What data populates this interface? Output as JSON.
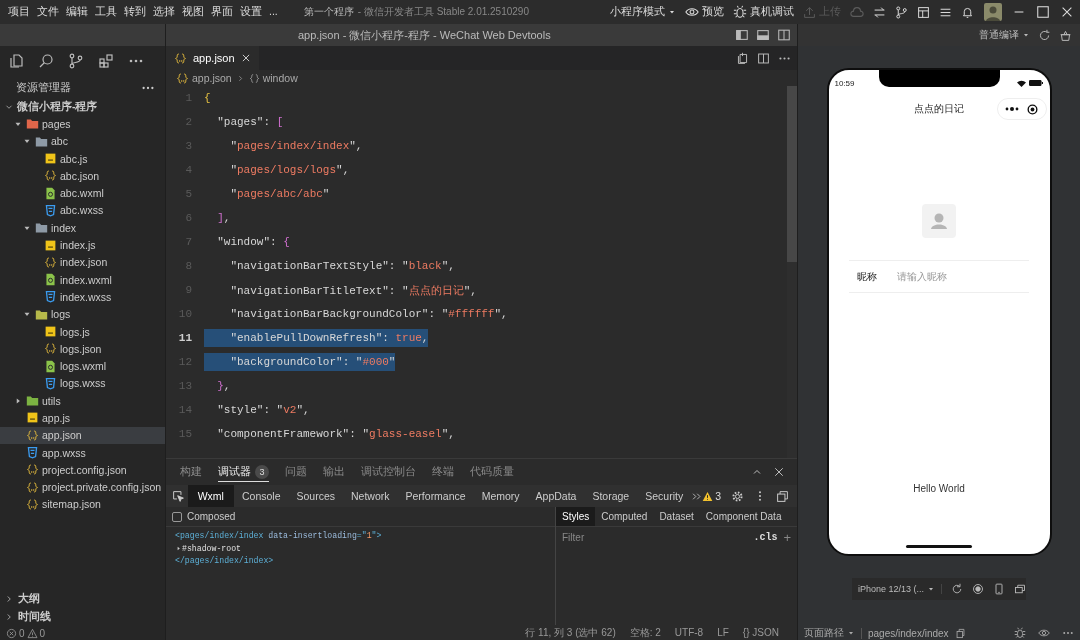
{
  "window": {
    "menu": [
      "项目",
      "文件",
      "编辑",
      "工具",
      "转到",
      "选择",
      "视图",
      "界面",
      "设置",
      "..."
    ],
    "project_name": "第一个程序",
    "app_title": "- 微信开发者工具 Stable 2.01.2510290",
    "toolbar": [
      {
        "kind": "mode",
        "label": "小程序模式",
        "disabled": false
      },
      {
        "kind": "preview",
        "label": "预览",
        "disabled": false
      },
      {
        "kind": "debug",
        "label": "真机调试",
        "disabled": false
      },
      {
        "kind": "upload",
        "label": "上传",
        "disabled": true
      },
      {
        "kind": "cloud",
        "disabled": true
      },
      {
        "kind": "swap",
        "disabled": false
      },
      {
        "kind": "branch",
        "disabled": false
      },
      {
        "kind": "layout",
        "disabled": false
      },
      {
        "kind": "list",
        "disabled": false
      },
      {
        "kind": "bell",
        "disabled": false
      }
    ],
    "document_title": "app.json - 微信小程序-程序 - WeChat Web Devtools"
  },
  "sidebar": {
    "title": "资源管理器",
    "tree": {
      "name": "微信小程序-程序",
      "kind": "project",
      "expanded": true,
      "selected": false,
      "children": [
        {
          "name": "pages",
          "kind": "folder",
          "color": "#e0664a",
          "expanded": true,
          "selected": false,
          "children": [
            {
              "name": "abc",
              "kind": "folder",
              "color": "#8e9aa6",
              "expanded": true,
              "selected": false,
              "children": [
                {
                  "name": "abc.js",
                  "kind": "js",
                  "selected": false
                },
                {
                  "name": "abc.json",
                  "kind": "json",
                  "selected": false
                },
                {
                  "name": "abc.wxml",
                  "kind": "wxml",
                  "selected": false
                },
                {
                  "name": "abc.wxss",
                  "kind": "wxss",
                  "selected": false
                }
              ]
            },
            {
              "name": "index",
              "kind": "folder",
              "color": "#8e9aa6",
              "expanded": true,
              "selected": false,
              "children": [
                {
                  "name": "index.js",
                  "kind": "js",
                  "selected": false
                },
                {
                  "name": "index.json",
                  "kind": "json",
                  "selected": false
                },
                {
                  "name": "index.wxml",
                  "kind": "wxml",
                  "selected": false
                },
                {
                  "name": "index.wxss",
                  "kind": "wxss",
                  "selected": false
                }
              ]
            },
            {
              "name": "logs",
              "kind": "folder",
              "color": "#b5b84a",
              "expanded": true,
              "selected": false,
              "children": [
                {
                  "name": "logs.js",
                  "kind": "js",
                  "selected": false
                },
                {
                  "name": "logs.json",
                  "kind": "json",
                  "selected": false
                },
                {
                  "name": "logs.wxml",
                  "kind": "wxml",
                  "selected": false
                },
                {
                  "name": "logs.wxss",
                  "kind": "wxss",
                  "selected": false
                }
              ]
            }
          ]
        },
        {
          "name": "utils",
          "kind": "folder",
          "color": "#7cb342",
          "expanded": false,
          "selected": false
        },
        {
          "name": "app.js",
          "kind": "js",
          "selected": false
        },
        {
          "name": "app.json",
          "kind": "json",
          "selected": true
        },
        {
          "name": "app.wxss",
          "kind": "wxss",
          "selected": false
        },
        {
          "name": "project.config.json",
          "kind": "json",
          "selected": false
        },
        {
          "name": "project.private.config.json",
          "kind": "json",
          "selected": false
        },
        {
          "name": "sitemap.json",
          "kind": "json",
          "selected": false
        }
      ]
    },
    "sections": [
      {
        "label": "大纲",
        "expanded": false
      },
      {
        "label": "时间线",
        "expanded": false
      }
    ],
    "problems": {
      "errors": "0",
      "warnings": "0"
    }
  },
  "editor": {
    "tabs": [
      {
        "label": "app.json",
        "kind": "json",
        "selected": true
      }
    ],
    "breadcrumb": [
      {
        "label": "app.json",
        "kind": "json"
      },
      {
        "label": "window",
        "kind": "object"
      }
    ],
    "lines": [
      {
        "number": "1",
        "selected": false,
        "current": false,
        "tokens": [
          {
            "kind": "bracket_outer",
            "text": "{"
          }
        ]
      },
      {
        "number": "2",
        "selected": false,
        "current": false,
        "tokens": [
          {
            "kind": "key",
            "text": "  \"pages\""
          },
          {
            "kind": "punct",
            "text": ": "
          },
          {
            "kind": "bracket_inner",
            "text": "["
          }
        ]
      },
      {
        "number": "3",
        "selected": false,
        "current": false,
        "tokens": [
          {
            "kind": "punct",
            "text": "    \""
          },
          {
            "kind": "string",
            "text": "pages/index/index"
          },
          {
            "kind": "punct",
            "text": "\","
          }
        ]
      },
      {
        "number": "4",
        "selected": false,
        "current": false,
        "tokens": [
          {
            "kind": "punct",
            "text": "    \""
          },
          {
            "kind": "string",
            "text": "pages/logs/logs"
          },
          {
            "kind": "punct",
            "text": "\","
          }
        ]
      },
      {
        "number": "5",
        "selected": false,
        "current": false,
        "tokens": [
          {
            "kind": "punct",
            "text": "    \""
          },
          {
            "kind": "string",
            "text": "pages/abc/abc"
          },
          {
            "kind": "punct",
            "text": "\""
          }
        ]
      },
      {
        "number": "6",
        "selected": false,
        "current": false,
        "tokens": [
          {
            "kind": "bracket_inner",
            "text": "  ]"
          },
          {
            "kind": "punct",
            "text": ","
          }
        ]
      },
      {
        "number": "7",
        "selected": false,
        "current": false,
        "tokens": [
          {
            "kind": "key",
            "text": "  \"window\""
          },
          {
            "kind": "punct",
            "text": ": "
          },
          {
            "kind": "bracket_inner",
            "text": "{"
          }
        ]
      },
      {
        "number": "8",
        "selected": false,
        "current": false,
        "tokens": [
          {
            "kind": "key",
            "text": "    \"navigationBarTextStyle\""
          },
          {
            "kind": "punct",
            "text": ": \""
          },
          {
            "kind": "string",
            "text": "black"
          },
          {
            "kind": "punct",
            "text": "\","
          }
        ]
      },
      {
        "number": "9",
        "selected": false,
        "current": false,
        "tokens": [
          {
            "kind": "key",
            "text": "    \"navigationBarTitleText\""
          },
          {
            "kind": "punct",
            "text": ": \""
          },
          {
            "kind": "string",
            "text": "点点的日记"
          },
          {
            "kind": "punct",
            "text": "\","
          }
        ]
      },
      {
        "number": "10",
        "selected": false,
        "current": false,
        "tokens": [
          {
            "kind": "key",
            "text": "    \"navigationBarBackgroundColor\""
          },
          {
            "kind": "punct",
            "text": ": \""
          },
          {
            "kind": "string",
            "text": "#ffffff"
          },
          {
            "kind": "punct",
            "text": "\","
          }
        ]
      },
      {
        "number": "11",
        "selected": true,
        "current": true,
        "tokens": [
          {
            "kind": "key",
            "text": "    \"enablePullDownRefresh\""
          },
          {
            "kind": "punct",
            "text": ": "
          },
          {
            "kind": "string",
            "text": "true"
          },
          {
            "kind": "punct",
            "text": ","
          }
        ]
      },
      {
        "number": "12",
        "selected": true,
        "current": false,
        "tokens": [
          {
            "kind": "key",
            "text": "    \"backgroundColor\""
          },
          {
            "kind": "punct",
            "text": ": \""
          },
          {
            "kind": "string",
            "text": "#000"
          },
          {
            "kind": "punct",
            "text": "\""
          }
        ]
      },
      {
        "number": "13",
        "selected": false,
        "current": false,
        "tokens": [
          {
            "kind": "bracket_inner",
            "text": "  }"
          },
          {
            "kind": "punct",
            "text": ","
          }
        ]
      },
      {
        "number": "14",
        "selected": false,
        "current": false,
        "tokens": [
          {
            "kind": "key",
            "text": "  \"style\""
          },
          {
            "kind": "punct",
            "text": ": \""
          },
          {
            "kind": "string",
            "text": "v2"
          },
          {
            "kind": "punct",
            "text": "\","
          }
        ]
      },
      {
        "number": "15",
        "selected": false,
        "current": false,
        "tokens": [
          {
            "kind": "key",
            "text": "  \"componentFramework\""
          },
          {
            "kind": "punct",
            "text": ": \""
          },
          {
            "kind": "string",
            "text": "glass-easel"
          },
          {
            "kind": "punct",
            "text": "\","
          }
        ]
      }
    ],
    "status": [
      "行 11, 列 3 (选中 62)",
      "空格: 2",
      "UTF-8",
      "LF",
      "{} JSON"
    ]
  },
  "panel": {
    "tabs": [
      {
        "label": "构建",
        "selected": false
      },
      {
        "label": "调试器",
        "selected": true,
        "badge": "3"
      },
      {
        "label": "问题",
        "selected": false
      },
      {
        "label": "输出",
        "selected": false
      },
      {
        "label": "调试控制台",
        "selected": false
      },
      {
        "label": "终端",
        "selected": false
      },
      {
        "label": "代码质量",
        "selected": false
      }
    ],
    "devtools_tabs": [
      {
        "label": "Wxml",
        "selected": true
      },
      {
        "label": "Console",
        "selected": false
      },
      {
        "label": "Sources",
        "selected": false
      },
      {
        "label": "Network",
        "selected": false
      },
      {
        "label": "Performance",
        "selected": false
      },
      {
        "label": "Memory",
        "selected": false
      },
      {
        "label": "AppData",
        "selected": false
      },
      {
        "label": "Storage",
        "selected": false
      },
      {
        "label": "Security",
        "selected": false
      }
    ],
    "warnings": "3",
    "composed": {
      "label": "Composed",
      "checked": false
    },
    "elements": [
      {
        "kind": "markup",
        "tokens": [
          {
            "kind": "tag",
            "text": "<pages/index/index"
          },
          {
            "kind": "attr",
            "text": " data-insertloading"
          },
          {
            "kind": "tag",
            "text": "=\""
          },
          {
            "kind": "value",
            "text": "1"
          },
          {
            "kind": "tag",
            "text": "\">"
          }
        ]
      },
      {
        "kind": "shadow_root",
        "text": "#shadow-root",
        "expanded": false
      },
      {
        "kind": "markup",
        "tokens": [
          {
            "kind": "tag",
            "text": "</pages/index/index>"
          }
        ]
      }
    ],
    "style_tabs": [
      {
        "label": "Styles",
        "selected": true
      },
      {
        "label": "Computed",
        "selected": false
      },
      {
        "label": "Dataset",
        "selected": false
      },
      {
        "label": "Component Data",
        "selected": false
      }
    ],
    "filter_placeholder": "Filter",
    "cls": ".cls",
    "add": "+"
  },
  "simulator": {
    "compile_mode": "普通编译",
    "phone": {
      "time": "10:59",
      "title": "点点的日记",
      "field_label": "昵称",
      "field_placeholder": "请输入昵称",
      "message": "Hello World"
    },
    "device": "iPhone 12/13 (...",
    "page_path_label": "页面路径",
    "page_path": "pages/index/index"
  }
}
